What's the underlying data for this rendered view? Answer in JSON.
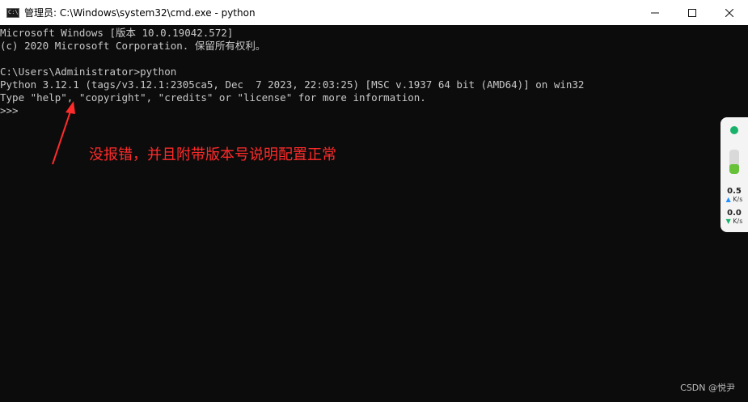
{
  "window": {
    "title": "管理员: C:\\Windows\\system32\\cmd.exe - python",
    "icon_prompt": "C:\\",
    "minimize_glyph": "—",
    "maximize_glyph": "☐",
    "close_glyph": "✕"
  },
  "console": {
    "lines": [
      "Microsoft Windows [版本 10.0.19042.572]",
      "(c) 2020 Microsoft Corporation. 保留所有权利。",
      "",
      "C:\\Users\\Administrator>python",
      "Python 3.12.1 (tags/v3.12.1:2305ca5, Dec  7 2023, 22:03:25) [MSC v.1937 64 bit (AMD64)] on win32",
      "Type \"help\", \"copyright\", \"credits\" or \"license\" for more information.",
      ">>>"
    ]
  },
  "annotation": {
    "text": "没报错，并且附带版本号说明配置正常",
    "color": "#ff2a2a"
  },
  "net_widget": {
    "status_color": "#19b26b",
    "gauge_level": 0.4,
    "upload_value": "0.5",
    "upload_unit": "K/s",
    "upload_icon": "arrow-up-icon",
    "download_value": "0.0",
    "download_unit": "K/s",
    "download_icon": "arrow-down-icon"
  },
  "watermark": "CSDN @悦尹",
  "colors": {
    "console_bg": "#0c0c0c",
    "console_text": "#c8c8c8",
    "titlebar_bg": "#ffffff"
  }
}
